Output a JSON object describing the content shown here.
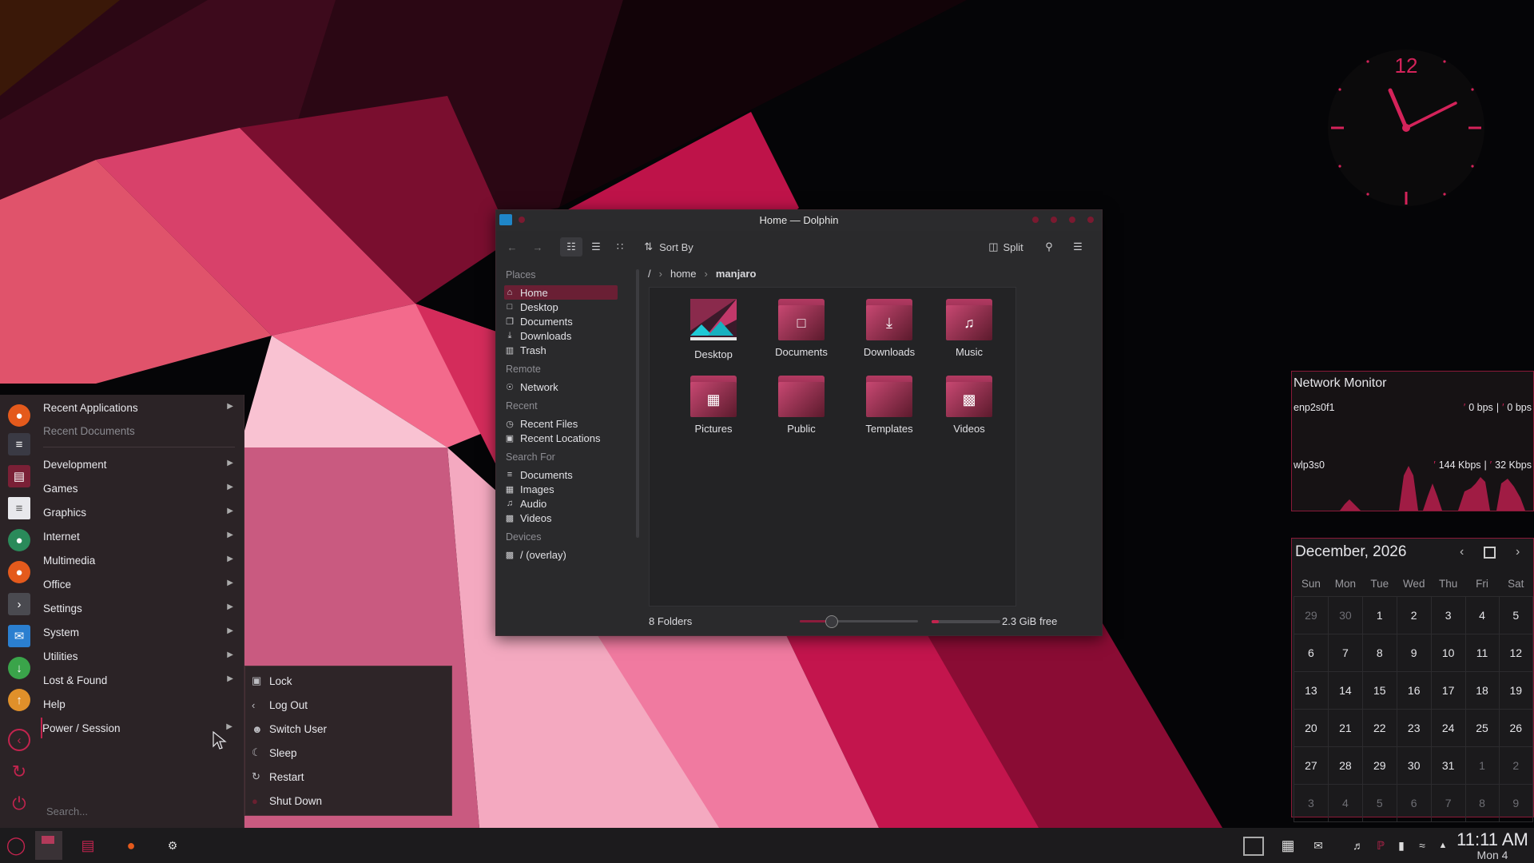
{
  "colors": {
    "accent": "#d4235a",
    "panel": "#2b2326",
    "window": "#2a2a2c",
    "highlight": "#6a1f34"
  },
  "dolphin": {
    "title": "Home — Dolphin",
    "sort_label": "Sort By",
    "split_label": "Split",
    "places": {
      "sections": {
        "places": "Places",
        "remote": "Remote",
        "recent": "Recent",
        "search": "Search For",
        "devices": "Devices"
      },
      "items": [
        {
          "label": "Home",
          "icon": "home-icon"
        },
        {
          "label": "Desktop",
          "icon": "desktop-icon"
        },
        {
          "label": "Documents",
          "icon": "documents-icon"
        },
        {
          "label": "Downloads",
          "icon": "download-icon"
        },
        {
          "label": "Trash",
          "icon": "trash-icon"
        },
        {
          "label": "Network",
          "icon": "network-icon"
        },
        {
          "label": "Recent Files",
          "icon": "clock-icon"
        },
        {
          "label": "Recent Locations",
          "icon": "recent-folder-icon"
        },
        {
          "label": "Documents",
          "icon": "text-icon"
        },
        {
          "label": "Images",
          "icon": "image-icon"
        },
        {
          "label": "Audio",
          "icon": "music-icon"
        },
        {
          "label": "Videos",
          "icon": "film-icon"
        },
        {
          "label": "/ (overlay)",
          "icon": "drive-icon"
        }
      ]
    },
    "breadcrumb": {
      "root": "/",
      "home": "home",
      "current": "manjaro"
    },
    "folders": [
      "Desktop",
      "Documents",
      "Downloads",
      "Music",
      "Pictures",
      "Public",
      "Templates",
      "Videos"
    ],
    "status_count": "8 Folders",
    "free_space": "2.3 GiB free",
    "disk_used_fraction": 0.1,
    "zoom_fraction": 0.27
  },
  "app_menu": {
    "items": [
      "Recent Applications",
      "Recent Documents",
      "Development",
      "Games",
      "Graphics",
      "Internet",
      "Multimedia",
      "Office",
      "Settings",
      "System",
      "Utilities",
      "Lost & Found",
      "Help",
      "Power / Session"
    ],
    "search_placeholder": "Search..."
  },
  "power_submenu": [
    "Lock",
    "Log Out",
    "Switch User",
    "Sleep",
    "Restart",
    "Shut Down"
  ],
  "clock": {
    "numeral": "12",
    "time_text": "11:11 AM",
    "date_text": "Mon 4"
  },
  "network_monitor": {
    "title": "Network Monitor",
    "interfaces": [
      {
        "name": "enp2s0f1",
        "down": "0 bps",
        "up": "0 bps",
        "sep": "|"
      },
      {
        "name": "wlp3s0",
        "down": "144 Kbps",
        "up": "32 Kbps",
        "sep": "|"
      }
    ]
  },
  "calendar": {
    "title": "December, 2026",
    "weekdays": [
      "Sun",
      "Mon",
      "Tue",
      "Wed",
      "Thu",
      "Fri",
      "Sat"
    ],
    "weeks": [
      [
        "29",
        "30",
        "1",
        "2",
        "3",
        "4",
        "5"
      ],
      [
        "6",
        "7",
        "8",
        "9",
        "10",
        "11",
        "12"
      ],
      [
        "13",
        "14",
        "15",
        "16",
        "17",
        "18",
        "19"
      ],
      [
        "20",
        "21",
        "22",
        "23",
        "24",
        "25",
        "26"
      ],
      [
        "27",
        "28",
        "29",
        "30",
        "31",
        "1",
        "2"
      ],
      [
        "3",
        "4",
        "5",
        "6",
        "7",
        "8",
        "9"
      ]
    ]
  }
}
